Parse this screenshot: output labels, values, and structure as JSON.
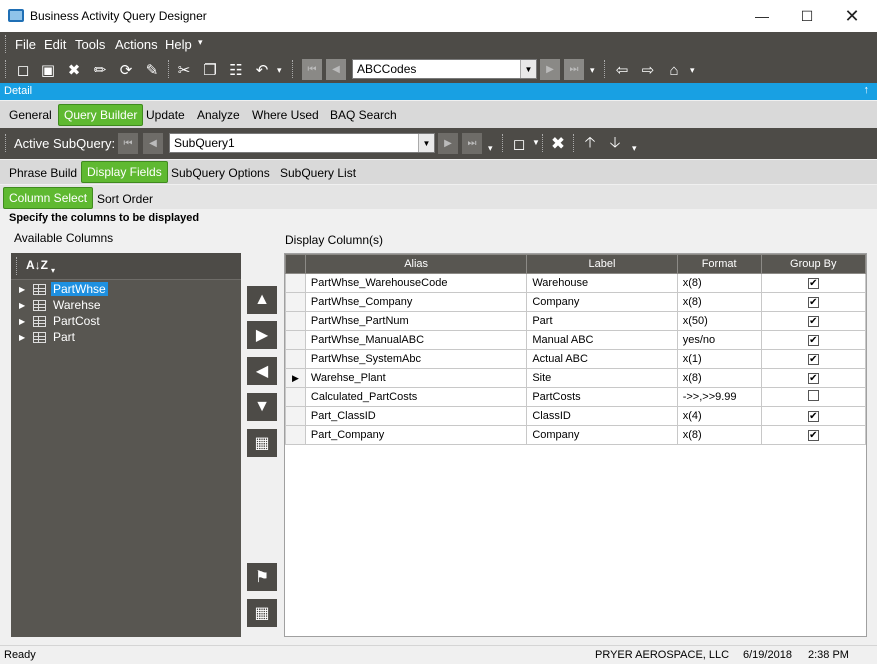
{
  "window": {
    "title": "Business Activity Query Designer"
  },
  "menu": [
    "File",
    "Edit",
    "Tools",
    "Actions",
    "Help"
  ],
  "toolbar": {
    "query_combo_value": "ABCCodes"
  },
  "detail_bar": {
    "label": "Detail",
    "pin": "↑"
  },
  "main_tabs": [
    "General",
    "Query Builder",
    "Update",
    "Analyze",
    "Where Used",
    "BAQ Search"
  ],
  "active_subquery": {
    "label": "Active SubQuery:",
    "value": "SubQuery1"
  },
  "sub_tabs": [
    "Phrase Build",
    "Display Fields",
    "SubQuery Options",
    "SubQuery List"
  ],
  "inner_tabs": [
    "Column Select",
    "Sort Order"
  ],
  "instruction": "Specify the columns to be displayed",
  "available_columns": {
    "label": "Available Columns",
    "sort_glyph": "A↓Z",
    "items": [
      "PartWhse",
      "Warehse",
      "PartCost",
      "Part"
    ],
    "selected": "PartWhse"
  },
  "display_columns": {
    "label": "Display Column(s)",
    "headers": [
      "Alias",
      "Label",
      "Format",
      "Group By"
    ],
    "rows": [
      {
        "alias": "PartWhse_WarehouseCode",
        "label": "Warehouse",
        "format": "x(8)",
        "group_by": true
      },
      {
        "alias": "PartWhse_Company",
        "label": "Company",
        "format": "x(8)",
        "group_by": true
      },
      {
        "alias": "PartWhse_PartNum",
        "label": "Part",
        "format": "x(50)",
        "group_by": true
      },
      {
        "alias": "PartWhse_ManualABC",
        "label": "Manual ABC",
        "format": "yes/no",
        "group_by": true
      },
      {
        "alias": "PartWhse_SystemAbc",
        "label": "Actual ABC",
        "format": "x(1)",
        "group_by": true
      },
      {
        "alias": "Warehse_Plant",
        "label": "Site",
        "format": "x(8)",
        "group_by": true
      },
      {
        "alias": "Calculated_PartCosts",
        "label": "PartCosts",
        "format": "->>,>>9.99",
        "group_by": false
      },
      {
        "alias": "Part_ClassID",
        "label": "ClassID",
        "format": "x(4)",
        "group_by": true
      },
      {
        "alias": "Part_Company",
        "label": "Company",
        "format": "x(8)",
        "group_by": true
      }
    ],
    "current_row": 5
  },
  "status": {
    "left": "Ready",
    "company": "PRYER AEROSPACE, LLC",
    "date": "6/19/2018",
    "time": "2:38 PM"
  },
  "colors": {
    "accent_green": "#5fb931",
    "detail_blue": "#18a0e3",
    "dark_toolbar": "#4d4b47"
  }
}
